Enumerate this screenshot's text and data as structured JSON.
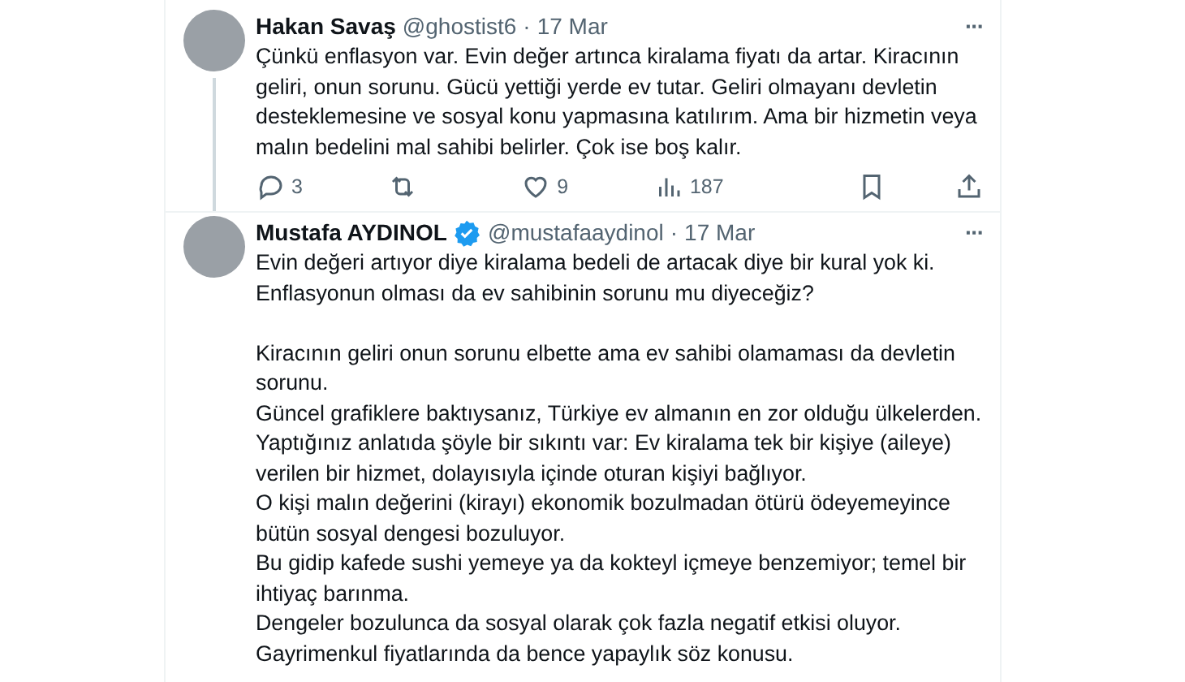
{
  "tweets": [
    {
      "name": "Hakan Savaş",
      "verified": false,
      "handle": "@ghostist6",
      "separator": "·",
      "date": "17 Mar",
      "more": "···",
      "thread_line": true,
      "blocks": [
        [
          "Çünkü enflasyon var. Evin değer artınca kiralama fiyatı da artar. Kiracının geliri, onun sorunu. Gücü yettiği yerde ev tutar. Geliri olmayanı devletin desteklemesine ve sosyal konu yapmasına katılırım. Ama bir hizmetin veya malın bedelini mal sahibi belirler. Çok ise boş kalır."
        ]
      ],
      "actions": [
        {
          "kind": "reply",
          "count": "3"
        },
        {
          "kind": "retweet"
        },
        {
          "kind": "like",
          "count": "9"
        },
        {
          "kind": "views",
          "count": "187"
        },
        {
          "kind": "bookmark"
        },
        {
          "kind": "share"
        }
      ]
    },
    {
      "name": "Mustafa AYDINOL",
      "verified": true,
      "handle": "@mustafaaydinol",
      "separator": "·",
      "date": "17 Mar",
      "more": "···",
      "thread_line": false,
      "blocks": [
        [
          "Evin değeri artıyor diye kiralama bedeli de artacak diye bir kural yok ki.",
          "Enflasyonun olması da ev sahibinin sorunu mu diyeceğiz?"
        ],
        [
          "Kiracının geliri onun sorunu elbette ama ev sahibi olamaması da devletin sorunu.",
          "Güncel grafiklere baktıysanız, Türkiye ev almanın en zor olduğu ülkelerden.",
          "Yaptığınız anlatıda şöyle bir sıkıntı var: Ev kiralama tek bir kişiye (aileye) verilen bir hizmet, dolayısıyla içinde oturan kişiyi bağlıyor.",
          "O kişi malın değerini (kirayı) ekonomik bozulmadan ötürü ödeyemeyince bütün sosyal dengesi bozuluyor.",
          "Bu gidip kafede sushi yemeye ya da kokteyl içmeye benzemiyor; temel bir ihtiyaç barınma.",
          "Dengeler bozulunca da sosyal olarak çok fazla negatif etkisi oluyor.",
          "Gayrimenkul fiyatlarında da bence yapaylık söz konusu."
        ]
      ]
    }
  ]
}
